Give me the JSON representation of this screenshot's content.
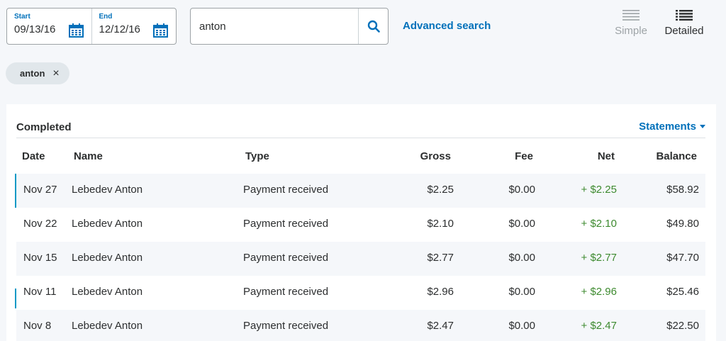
{
  "date_range": {
    "start_label": "Start",
    "start_value": "09/13/16",
    "end_label": "End",
    "end_value": "12/12/16"
  },
  "search": {
    "value": "anton",
    "advanced_label": "Advanced search"
  },
  "view": {
    "simple_label": "Simple",
    "detailed_label": "Detailed",
    "selected": "Detailed"
  },
  "filter_chip": {
    "label": "anton",
    "close_glyph": "×"
  },
  "activity": {
    "section_title": "Completed",
    "statements_label": "Statements",
    "columns": [
      "Date",
      "Name",
      "Type",
      "Gross",
      "Fee",
      "Net",
      "Balance"
    ],
    "rows": [
      {
        "date": "Nov 27",
        "name": "Lebedev Anton",
        "type": "Payment received",
        "gross": "$2.25",
        "fee": "$0.00",
        "net": "+ $2.25",
        "balance": "$58.92"
      },
      {
        "date": "Nov 22",
        "name": "Lebedev Anton",
        "type": "Payment received",
        "gross": "$2.10",
        "fee": "$0.00",
        "net": "+ $2.10",
        "balance": "$49.80"
      },
      {
        "date": "Nov 15",
        "name": "Lebedev Anton",
        "type": "Payment received",
        "gross": "$2.77",
        "fee": "$0.00",
        "net": "+ $2.77",
        "balance": "$47.70"
      },
      {
        "date": "Nov 11",
        "name": "Lebedev Anton",
        "type": "Payment received",
        "gross": "$2.96",
        "fee": "$0.00",
        "net": "+ $2.96",
        "balance": "$25.46"
      },
      {
        "date": "Nov 8",
        "name": "Lebedev Anton",
        "type": "Payment received",
        "gross": "$2.47",
        "fee": "$0.00",
        "net": "+ $2.47",
        "balance": "$22.50"
      }
    ]
  },
  "colors": {
    "accent": "#0070ba",
    "positive": "#3d8a2f",
    "row_marker": "#0099c6"
  }
}
